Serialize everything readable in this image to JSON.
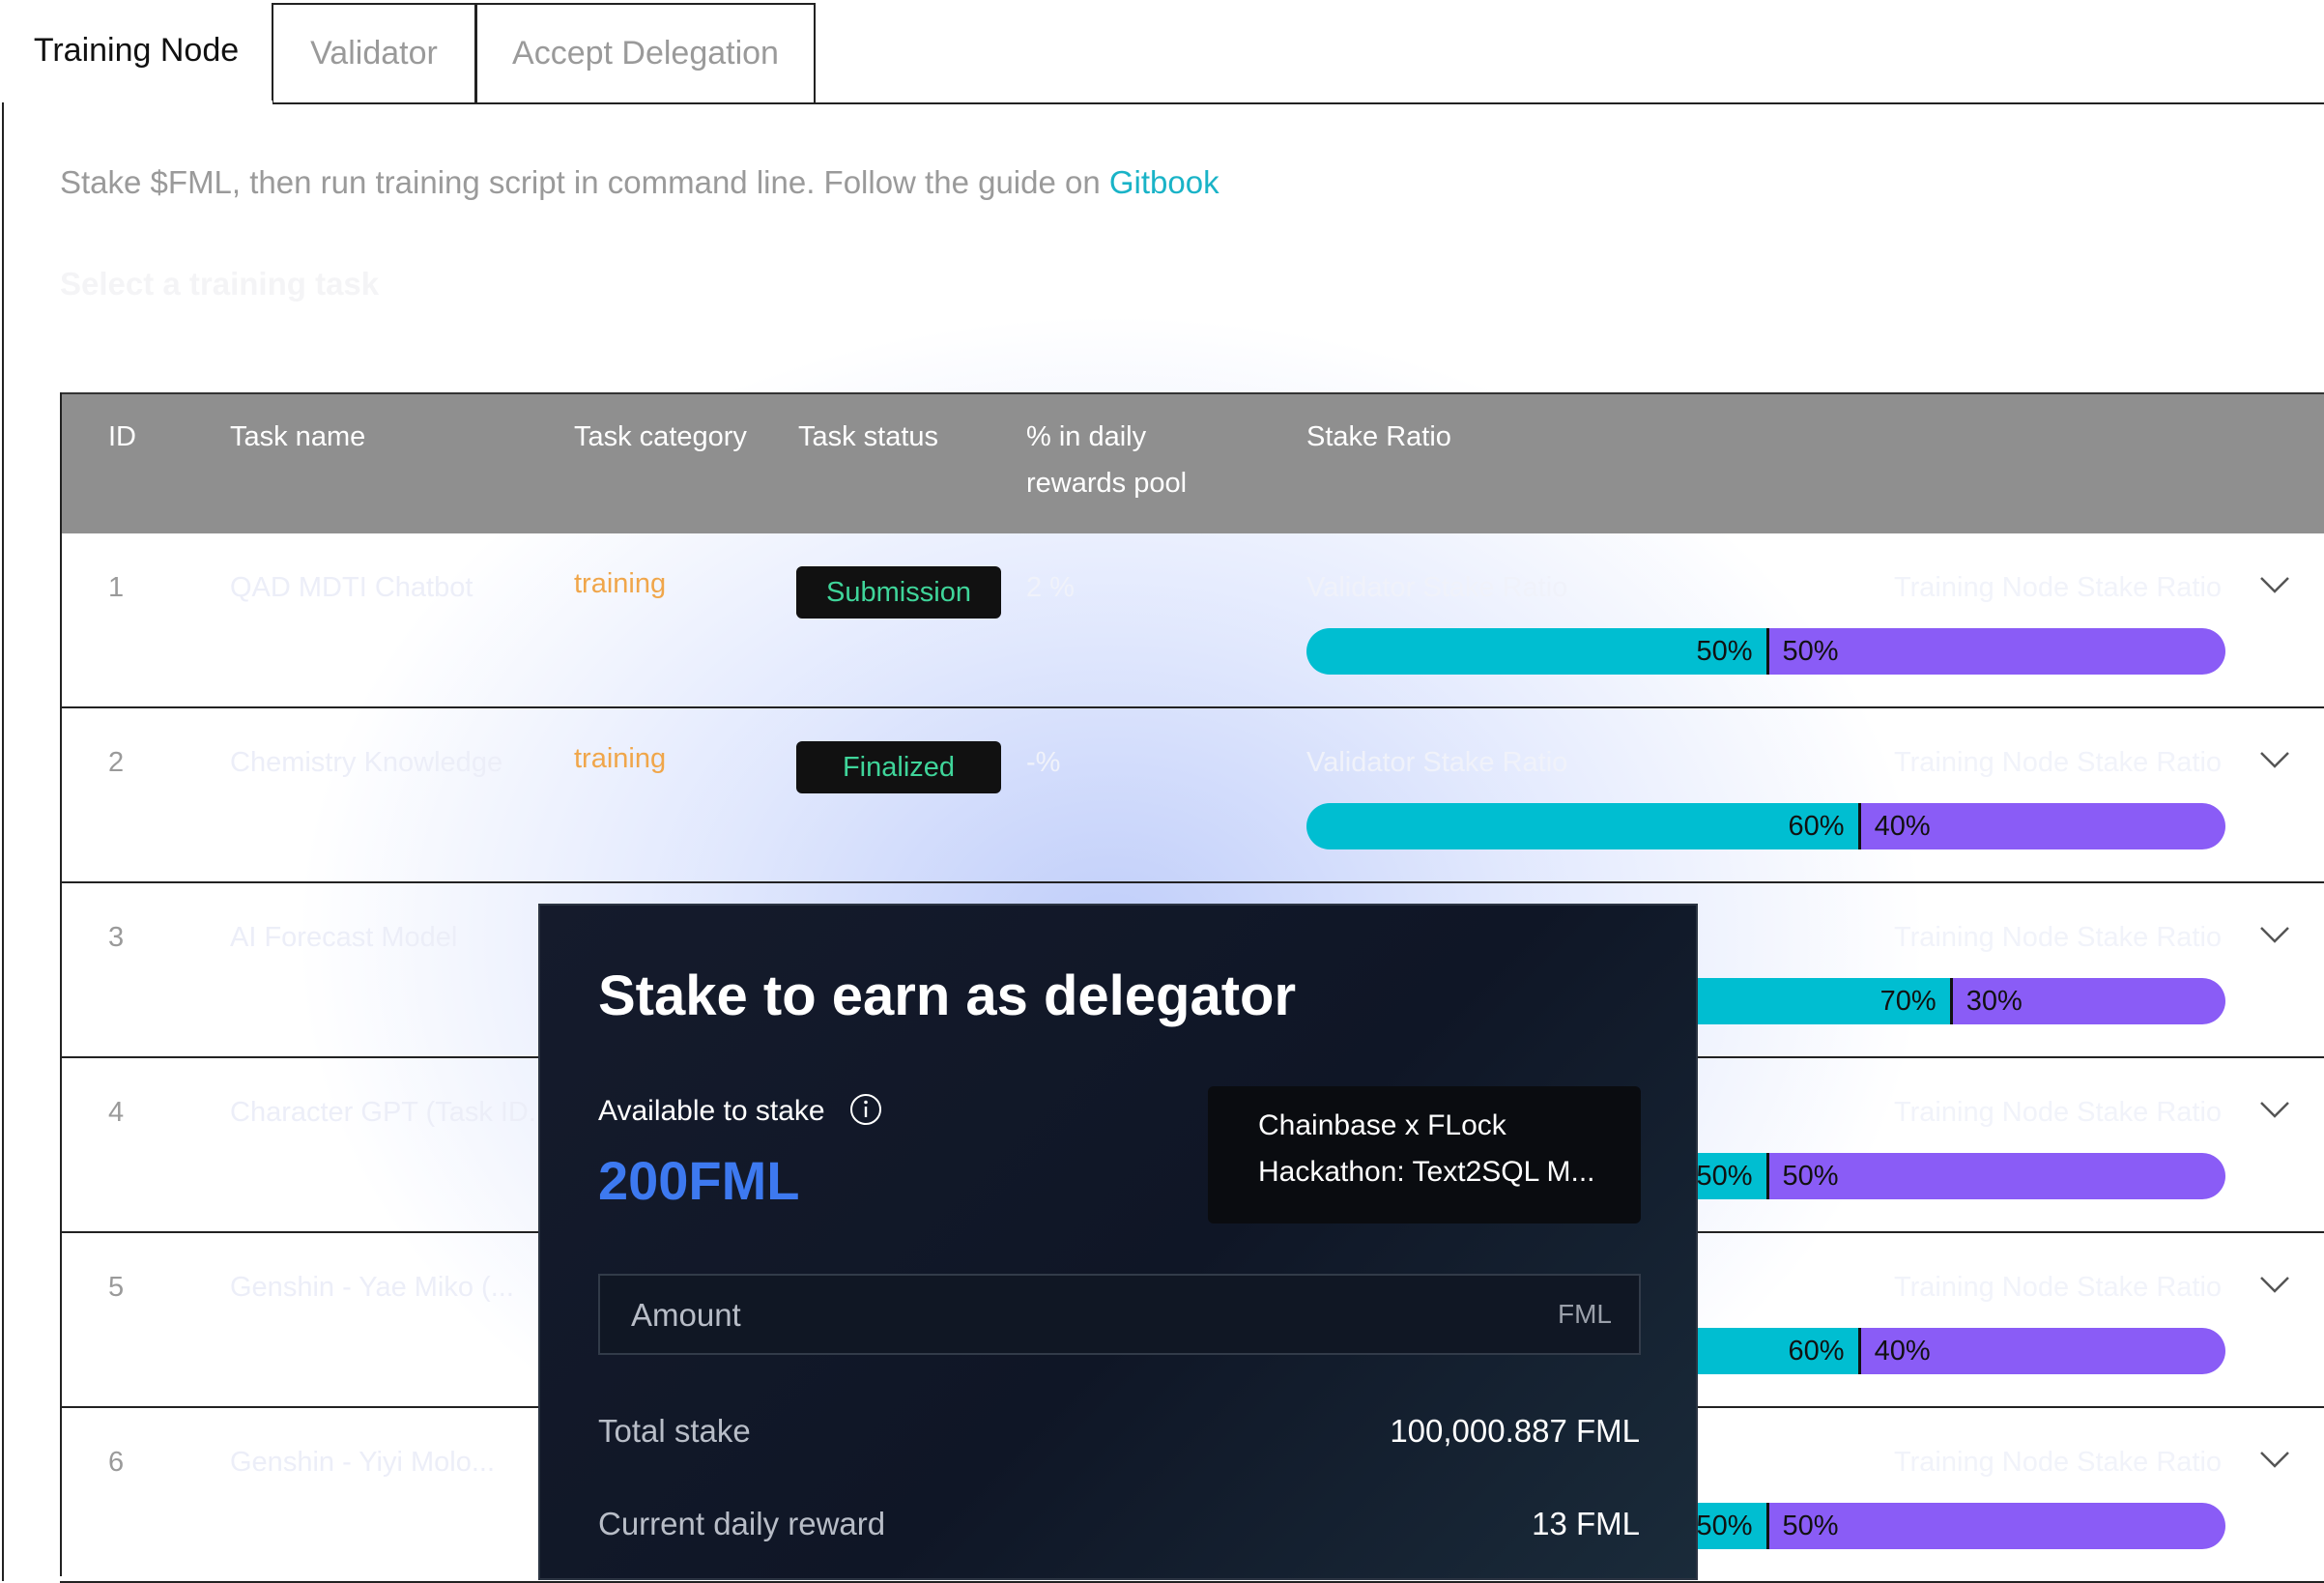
{
  "tabs": [
    {
      "label": "Training Node",
      "active": true
    },
    {
      "label": "Validator",
      "active": false
    },
    {
      "label": "Accept Delegation",
      "active": false
    }
  ],
  "intro": {
    "text": "Stake $FML, then run training script in command line. Follow the guide on ",
    "link": "Gitbook"
  },
  "select_label": "Select a training task",
  "table": {
    "headers": {
      "id": "ID",
      "task_name": "Task name",
      "task_category": "Task category",
      "task_status": "Task status",
      "pct_line1": "% in daily",
      "pct_line2": "rewards pool",
      "stake_ratio": "Stake Ratio"
    },
    "rows": [
      {
        "id": "1",
        "name": "QAD MDTI Chatbot",
        "category": "training",
        "status": "Submission",
        "pct": "2 %",
        "left_label": "Validator Stake Ratio",
        "right_label": "Training Node Stake Ratio",
        "left_value": "50%",
        "right_value": "50%",
        "left_fraction": 0.5
      },
      {
        "id": "2",
        "name": "Chemistry Knowledge",
        "category": "training",
        "status": "Finalized",
        "pct": "-%",
        "left_label": "Validator Stake Ratio",
        "right_label": "Training Node Stake Ratio",
        "left_value": "60%",
        "right_value": "40%",
        "left_fraction": 0.6
      },
      {
        "id": "3",
        "name": "AI Forecast Model",
        "category": "",
        "status": "",
        "pct": "",
        "left_label": "",
        "right_label": "Training Node Stake Ratio",
        "left_value": "70%",
        "right_value": "30%",
        "left_fraction": 0.7
      },
      {
        "id": "4",
        "name": "Character GPT (Task ID...",
        "category": "",
        "status": "",
        "pct": "",
        "left_label": "",
        "right_label": "Training Node Stake Ratio",
        "left_value": "50%",
        "right_value": "50%",
        "left_fraction": 0.5
      },
      {
        "id": "5",
        "name": "Genshin - Yae Miko (...",
        "category": "",
        "status": "",
        "pct": "",
        "left_label": "",
        "right_label": "Training Node Stake Ratio",
        "left_value": "60%",
        "right_value": "40%",
        "left_fraction": 0.6
      },
      {
        "id": "6",
        "name": "Genshin - Yiyi Molo...",
        "category": "",
        "status": "",
        "pct": "",
        "left_label": "",
        "right_label": "Training Node Stake Ratio",
        "left_value": "50%",
        "right_value": "50%",
        "left_fraction": 0.5
      }
    ]
  },
  "modal": {
    "title": "Stake to earn as delegator",
    "available_label": "Available to stake",
    "available_amount": "200FML",
    "task_line1": "Chainbase x FLock",
    "task_line2": "Hackathon: Text2SQL M...",
    "amount_placeholder": "Amount",
    "amount_unit": "FML",
    "total_stake_label": "Total stake",
    "total_stake_value": "100,000.887 FML",
    "daily_reward_label": "Current daily reward",
    "daily_reward_value": "13 FML"
  },
  "colors": {
    "cyan": "#00bed1",
    "purple": "#8a5cf6",
    "status_green": "#3fd59a",
    "category_orange": "#f0a64a",
    "link": "#19b3c7",
    "amount_blue": "#3d79f0"
  }
}
